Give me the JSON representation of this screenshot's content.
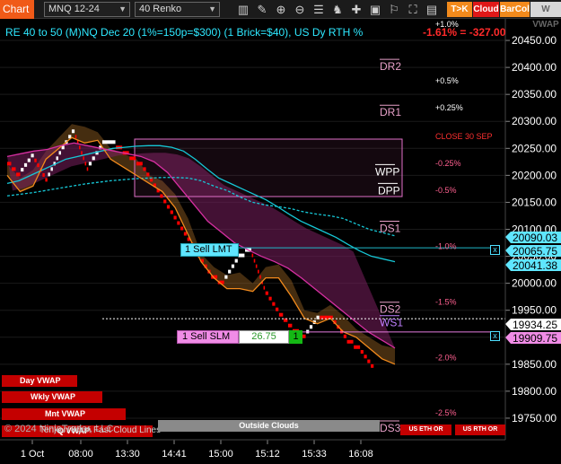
{
  "toolbar": {
    "chart_tab": "Chart",
    "instrument": "MNQ 12-24",
    "bar_type": "40 Renko",
    "btn_tk": "T>K",
    "btn_cloud": "Cloud",
    "btn_barcol": "BarCol",
    "btn_vwap": "W VWAP"
  },
  "colors": {
    "up_bar": "#ffffff",
    "down_bar": "#ff0000",
    "cloud_orange": "#b5762a",
    "cloud_purple": "#7a1f5e",
    "line_cyan": "#16c7d6",
    "line_orange": "#f28a1c",
    "line_magenta": "#d62fa1",
    "order_line": "#1fb8c8"
  },
  "chart_data": {
    "type": "line",
    "title": "RE 40 to 50 (M)NQ Dec 20 (1%=150p=$300) (1 Brick=$40), US Dy RTH %",
    "pnl_text": "-1.61% = -327.00",
    "ylim": [
      19710,
      20490
    ],
    "y_ticks": [
      "20450.00",
      "20400.00",
      "20350.00",
      "20300.00",
      "20250.00",
      "20200.00",
      "20150.00",
      "20100.00",
      "20050.00",
      "20000.00",
      "19950.00",
      "19900.00",
      "19850.00",
      "19800.00",
      "19750.00"
    ],
    "x_ticks": [
      "1 Oct",
      "08:00",
      "13:30",
      "14:41",
      "15:00",
      "15:12",
      "15:33",
      "16:08"
    ],
    "price_labels": [
      {
        "text": "20090.03",
        "value": 20090.03,
        "style": "cyan"
      },
      {
        "text": "20065.75",
        "value": 20065.75,
        "style": "cyan"
      },
      {
        "text": "20041.38",
        "value": 20041.38,
        "style": "cyan"
      },
      {
        "text": "19934.25",
        "value": 19934.25,
        "style": "white"
      },
      {
        "text": "19909.75",
        "value": 19909.75,
        "style": "magenta"
      }
    ],
    "pivot_labels": [
      {
        "text": "DR2",
        "value": 20400
      },
      {
        "text": "DR1",
        "value": 20315
      },
      {
        "text": "WPP",
        "value": 20205
      },
      {
        "text": "DPP",
        "value": 20170
      },
      {
        "text": "DS1",
        "value": 20100
      },
      {
        "text": "DS2",
        "value": 19950
      },
      {
        "text": "WS1",
        "value": 19925
      },
      {
        "text": "DS3",
        "value": 19730
      }
    ],
    "percent_labels": [
      {
        "text": "+1.0%",
        "value": 20480,
        "color": "#ffffff"
      },
      {
        "text": "+0.5%",
        "value": 20375,
        "color": "#ffffff"
      },
      {
        "text": "+0.25%",
        "value": 20325,
        "color": "#ffffff"
      },
      {
        "text": "CLOSE 30 SEP",
        "value": 20272,
        "color": "#ff3030"
      },
      {
        "text": "-0.25%",
        "value": 20222,
        "color": "#ff6090"
      },
      {
        "text": "-0.5%",
        "value": 20172,
        "color": "#ff6090"
      },
      {
        "text": "-1.0%",
        "value": 20068,
        "color": "#ff6090"
      },
      {
        "text": "-1.5%",
        "value": 19965,
        "color": "#ff6090"
      },
      {
        "text": "-2.0%",
        "value": 19862,
        "color": "#ff6090"
      },
      {
        "text": "-2.5%",
        "value": 19760,
        "color": "#ff6090"
      }
    ],
    "series": [
      {
        "values": [
          20185,
          20190,
          20200,
          20210,
          20220,
          20230,
          20235,
          20240,
          20245,
          20250,
          20252,
          20254,
          20255,
          20255,
          20252,
          20245,
          20230,
          20212,
          20195,
          20185,
          20175,
          20165,
          20155,
          20142,
          20128,
          20115,
          20105,
          20095,
          20085,
          20072,
          20060,
          20050,
          20045,
          20040
        ]
      },
      {
        "values": [
          20162,
          20165,
          20168,
          20172,
          20176,
          20180,
          20184,
          20187,
          20190,
          20192,
          20194,
          20195,
          20196,
          20196,
          20195,
          20190,
          20180,
          20172,
          20160,
          20150,
          20145,
          20142,
          20138,
          20132,
          20128,
          20125,
          20120,
          20110,
          20100,
          20094,
          20088
        ]
      },
      {
        "values": [
          20200,
          20170,
          20180,
          20230,
          20250,
          20270,
          20260,
          20265,
          20230,
          20215,
          20200,
          20185,
          20170,
          20140,
          20090,
          20040,
          20010,
          19990,
          19990,
          19985,
          20010,
          20010,
          19975,
          19935,
          19925,
          19935,
          19910,
          19900,
          19880,
          19860,
          19850
        ]
      },
      {
        "values": [
          20235,
          20240,
          20245,
          20248,
          20255,
          20260,
          20255,
          20250,
          20245,
          20240,
          20235,
          20225,
          20205,
          20175,
          20145,
          20115,
          20095,
          20075,
          20062,
          20050,
          20040,
          20028,
          20010,
          19990,
          19970,
          19950,
          19930,
          19910,
          19895,
          19880
        ]
      }
    ],
    "bricks": [
      20230,
      20200,
      20235,
      20190,
      20240,
      20280,
      20210,
      20250,
      20260,
      20240,
      20220,
      20180,
      20140,
      20100,
      20060,
      20020,
      20000,
      20040,
      20060,
      19990,
      19950,
      19920,
      19900,
      19935,
      19935,
      19900,
      19880,
      19845
    ]
  },
  "orders": {
    "sell_lmt": "1 Sell LMT",
    "sell_slm": "1 Sell SLM",
    "slm_price": "26.75",
    "slm_qty": "1",
    "close_x": "x"
  },
  "vwap_buttons": {
    "day": "Day VWAP",
    "wkly": "Wkly VWAP",
    "mnt": "Mnt VWAP",
    "q": "Q VWAP"
  },
  "bottom": {
    "watermark": "© 2024 NinjaTrader, LLC",
    "overlay_text": "Tenkan Kijun Fast Cloud Lines",
    "outside_clouds": "Outside Clouds",
    "us_eth_or": "US ETH OR",
    "us_rth_or": "US RTH OR"
  }
}
